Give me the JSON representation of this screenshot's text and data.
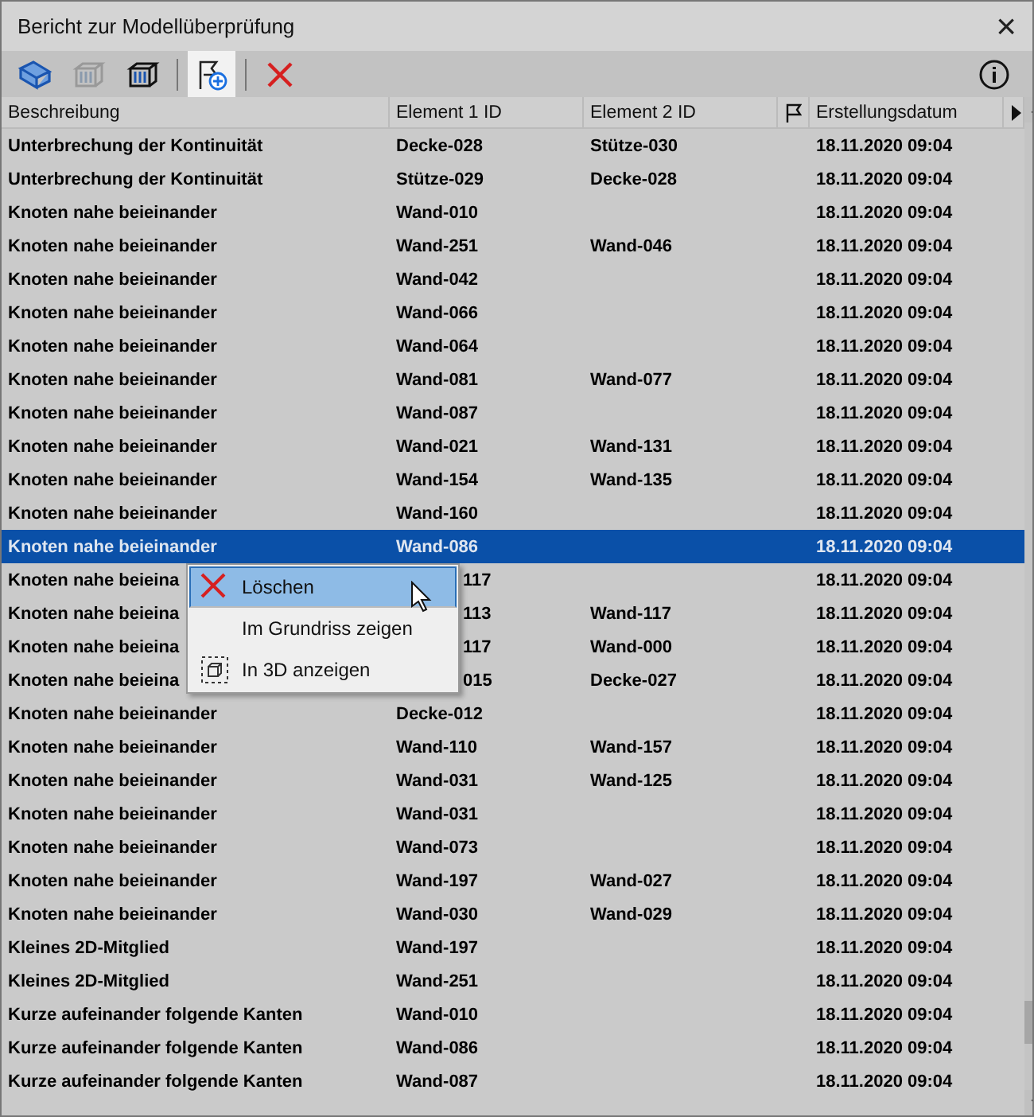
{
  "window": {
    "title": "Bericht zur Modellüberprüfung",
    "close": "×"
  },
  "toolbar": [
    {
      "kind": "model",
      "selected": false,
      "disabled": false
    },
    {
      "kind": "wall",
      "selected": false,
      "disabled": true
    },
    {
      "kind": "wall",
      "selected": false,
      "disabled": false
    },
    {
      "kind": "separator"
    },
    {
      "kind": "add",
      "selected": true,
      "disabled": false
    },
    {
      "kind": "separator"
    },
    {
      "kind": "delete",
      "selected": false,
      "disabled": false
    }
  ],
  "table": {
    "columns": [
      "Beschreibung",
      "Element 1 ID",
      "Element 2 ID",
      "",
      "Erstellungsdatum"
    ],
    "rows": [
      {
        "description": "Unterbrechung der Kontinuität",
        "element_1": "Decke-028",
        "element_2": "Stütze-030",
        "date": "18.11.2020 09:04",
        "selected": false,
        "covered": false
      },
      {
        "description": "Unterbrechung der Kontinuität",
        "element_1": "Stütze-029",
        "element_2": "Decke-028",
        "date": "18.11.2020 09:04",
        "selected": false,
        "covered": false
      },
      {
        "description": "Knoten nahe beieinander",
        "element_1": "Wand-010",
        "element_2": "",
        "date": "18.11.2020 09:04",
        "selected": false,
        "covered": false
      },
      {
        "description": "Knoten nahe beieinander",
        "element_1": "Wand-251",
        "element_2": "Wand-046",
        "date": "18.11.2020 09:04",
        "selected": false,
        "covered": false
      },
      {
        "description": "Knoten nahe beieinander",
        "element_1": "Wand-042",
        "element_2": "",
        "date": "18.11.2020 09:04",
        "selected": false,
        "covered": false
      },
      {
        "description": "Knoten nahe beieinander",
        "element_1": "Wand-066",
        "element_2": "",
        "date": "18.11.2020 09:04",
        "selected": false,
        "covered": false
      },
      {
        "description": "Knoten nahe beieinander",
        "element_1": "Wand-064",
        "element_2": "",
        "date": "18.11.2020 09:04",
        "selected": false,
        "covered": false
      },
      {
        "description": "Knoten nahe beieinander",
        "element_1": "Wand-081",
        "element_2": "Wand-077",
        "date": "18.11.2020 09:04",
        "selected": false,
        "covered": false
      },
      {
        "description": "Knoten nahe beieinander",
        "element_1": "Wand-087",
        "element_2": "",
        "date": "18.11.2020 09:04",
        "selected": false,
        "covered": false
      },
      {
        "description": "Knoten nahe beieinander",
        "element_1": "Wand-021",
        "element_2": "Wand-131",
        "date": "18.11.2020 09:04",
        "selected": false,
        "covered": false
      },
      {
        "description": "Knoten nahe beieinander",
        "element_1": "Wand-154",
        "element_2": "Wand-135",
        "date": "18.11.2020 09:04",
        "selected": false,
        "covered": false
      },
      {
        "description": "Knoten nahe beieinander",
        "element_1": "Wand-160",
        "element_2": "",
        "date": "18.11.2020 09:04",
        "selected": false,
        "covered": false
      },
      {
        "description": "Knoten nahe beieinander",
        "element_1": "Wand-086",
        "element_2": "",
        "date": "18.11.2020 09:04",
        "selected": true,
        "covered": false
      },
      {
        "description": "Knoten nahe beieina",
        "element_1": "117",
        "element_2": "",
        "date": "18.11.2020 09:04",
        "selected": false,
        "covered": true
      },
      {
        "description": "Knoten nahe beieina",
        "element_1": "113",
        "element_2": "Wand-117",
        "date": "18.11.2020 09:04",
        "selected": false,
        "covered": true
      },
      {
        "description": "Knoten nahe beieina",
        "element_1": "117",
        "element_2": "Wand-000",
        "date": "18.11.2020 09:04",
        "selected": false,
        "covered": true
      },
      {
        "description": "Knoten nahe beieina",
        "element_1": "015",
        "element_2": "Decke-027",
        "date": "18.11.2020 09:04",
        "selected": false,
        "covered": true
      },
      {
        "description": "Knoten nahe beieinander",
        "element_1": "Decke-012",
        "element_2": "",
        "date": "18.11.2020 09:04",
        "selected": false,
        "covered": false
      },
      {
        "description": "Knoten nahe beieinander",
        "element_1": "Wand-110",
        "element_2": "Wand-157",
        "date": "18.11.2020 09:04",
        "selected": false,
        "covered": false
      },
      {
        "description": "Knoten nahe beieinander",
        "element_1": "Wand-031",
        "element_2": "Wand-125",
        "date": "18.11.2020 09:04",
        "selected": false,
        "covered": false
      },
      {
        "description": "Knoten nahe beieinander",
        "element_1": "Wand-031",
        "element_2": "",
        "date": "18.11.2020 09:04",
        "selected": false,
        "covered": false
      },
      {
        "description": "Knoten nahe beieinander",
        "element_1": "Wand-073",
        "element_2": "",
        "date": "18.11.2020 09:04",
        "selected": false,
        "covered": false
      },
      {
        "description": "Knoten nahe beieinander",
        "element_1": "Wand-197",
        "element_2": "Wand-027",
        "date": "18.11.2020 09:04",
        "selected": false,
        "covered": false
      },
      {
        "description": "Knoten nahe beieinander",
        "element_1": "Wand-030",
        "element_2": "Wand-029",
        "date": "18.11.2020 09:04",
        "selected": false,
        "covered": false
      },
      {
        "description": "Kleines 2D-Mitglied",
        "element_1": "Wand-197",
        "element_2": "",
        "date": "18.11.2020 09:04",
        "selected": false,
        "covered": false
      },
      {
        "description": "Kleines 2D-Mitglied",
        "element_1": "Wand-251",
        "element_2": "",
        "date": "18.11.2020 09:04",
        "selected": false,
        "covered": false
      },
      {
        "description": "Kurze aufeinander folgende Kanten",
        "element_1": "Wand-010",
        "element_2": "",
        "date": "18.11.2020 09:04",
        "selected": false,
        "covered": false
      },
      {
        "description": "Kurze aufeinander folgende Kanten",
        "element_1": "Wand-086",
        "element_2": "",
        "date": "18.11.2020 09:04",
        "selected": false,
        "covered": false
      },
      {
        "description": "Kurze aufeinander folgende Kanten",
        "element_1": "Wand-087",
        "element_2": "",
        "date": "18.11.2020 09:04",
        "selected": false,
        "covered": false
      }
    ]
  },
  "context_menu": [
    {
      "label": "Löschen",
      "kind": "delete",
      "selected": true
    },
    {
      "label": "Im Grundriss zeigen",
      "kind": "plain",
      "selected": false
    },
    {
      "label": "In 3D anzeigen",
      "kind": "cube",
      "selected": false
    }
  ]
}
